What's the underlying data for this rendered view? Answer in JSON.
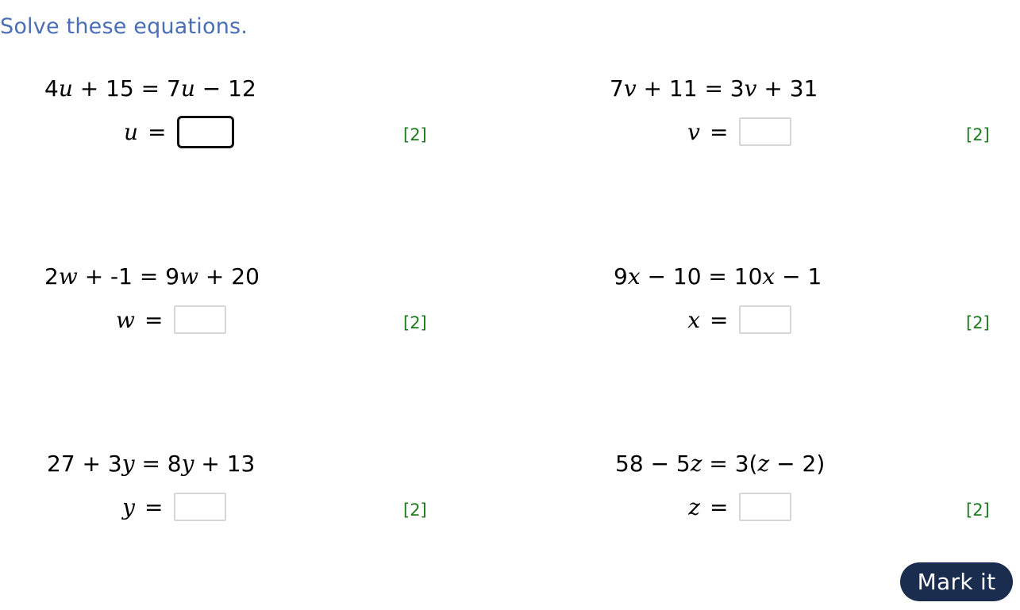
{
  "title": "Solve these equations.",
  "questions": [
    {
      "equation": [
        {
          "t": "4",
          "v": false
        },
        {
          "t": "u",
          "v": true
        },
        {
          "t": " + 15 = 7",
          "v": false
        },
        {
          "t": "u",
          "v": true
        },
        {
          "t": " − 12",
          "v": false
        }
      ],
      "variable": "u",
      "equals": "=",
      "value": "",
      "focused": true,
      "marks": "[2]"
    },
    {
      "equation": [
        {
          "t": "7",
          "v": false
        },
        {
          "t": "v",
          "v": true
        },
        {
          "t": " + 11 = 3",
          "v": false
        },
        {
          "t": "v",
          "v": true
        },
        {
          "t": " + 31",
          "v": false
        }
      ],
      "variable": "v",
      "equals": "=",
      "value": "",
      "focused": false,
      "marks": "[2]"
    },
    {
      "equation": [
        {
          "t": "2",
          "v": false
        },
        {
          "t": "w",
          "v": true
        },
        {
          "t": " + -1 = 9",
          "v": false
        },
        {
          "t": "w",
          "v": true
        },
        {
          "t": " + 20",
          "v": false
        }
      ],
      "variable": "w",
      "equals": "=",
      "value": "",
      "focused": false,
      "marks": "[2]"
    },
    {
      "equation": [
        {
          "t": "9",
          "v": false
        },
        {
          "t": "x",
          "v": true
        },
        {
          "t": " − 10 = 10",
          "v": false
        },
        {
          "t": "x",
          "v": true
        },
        {
          "t": " − 1",
          "v": false
        }
      ],
      "variable": "x",
      "equals": "=",
      "value": "",
      "focused": false,
      "marks": "[2]"
    },
    {
      "equation": [
        {
          "t": "27 + 3",
          "v": false
        },
        {
          "t": "y",
          "v": true
        },
        {
          "t": " = 8",
          "v": false
        },
        {
          "t": "y",
          "v": true
        },
        {
          "t": " + 13",
          "v": false
        }
      ],
      "variable": "y",
      "equals": "=",
      "value": "",
      "focused": false,
      "marks": "[2]"
    },
    {
      "equation": [
        {
          "t": "58 − 5",
          "v": false
        },
        {
          "t": "z",
          "v": true
        },
        {
          "t": " = 3(",
          "v": false
        },
        {
          "t": "z",
          "v": true
        },
        {
          "t": " − 2)",
          "v": false
        }
      ],
      "variable": "z",
      "equals": "=",
      "value": "",
      "focused": false,
      "marks": "[2]"
    }
  ],
  "submit_label": "Mark it",
  "colors": {
    "title": "#4a6fb5",
    "marks": "#1f7a1f",
    "button_bg": "#1b2d4f",
    "button_text": "#ffffff"
  }
}
